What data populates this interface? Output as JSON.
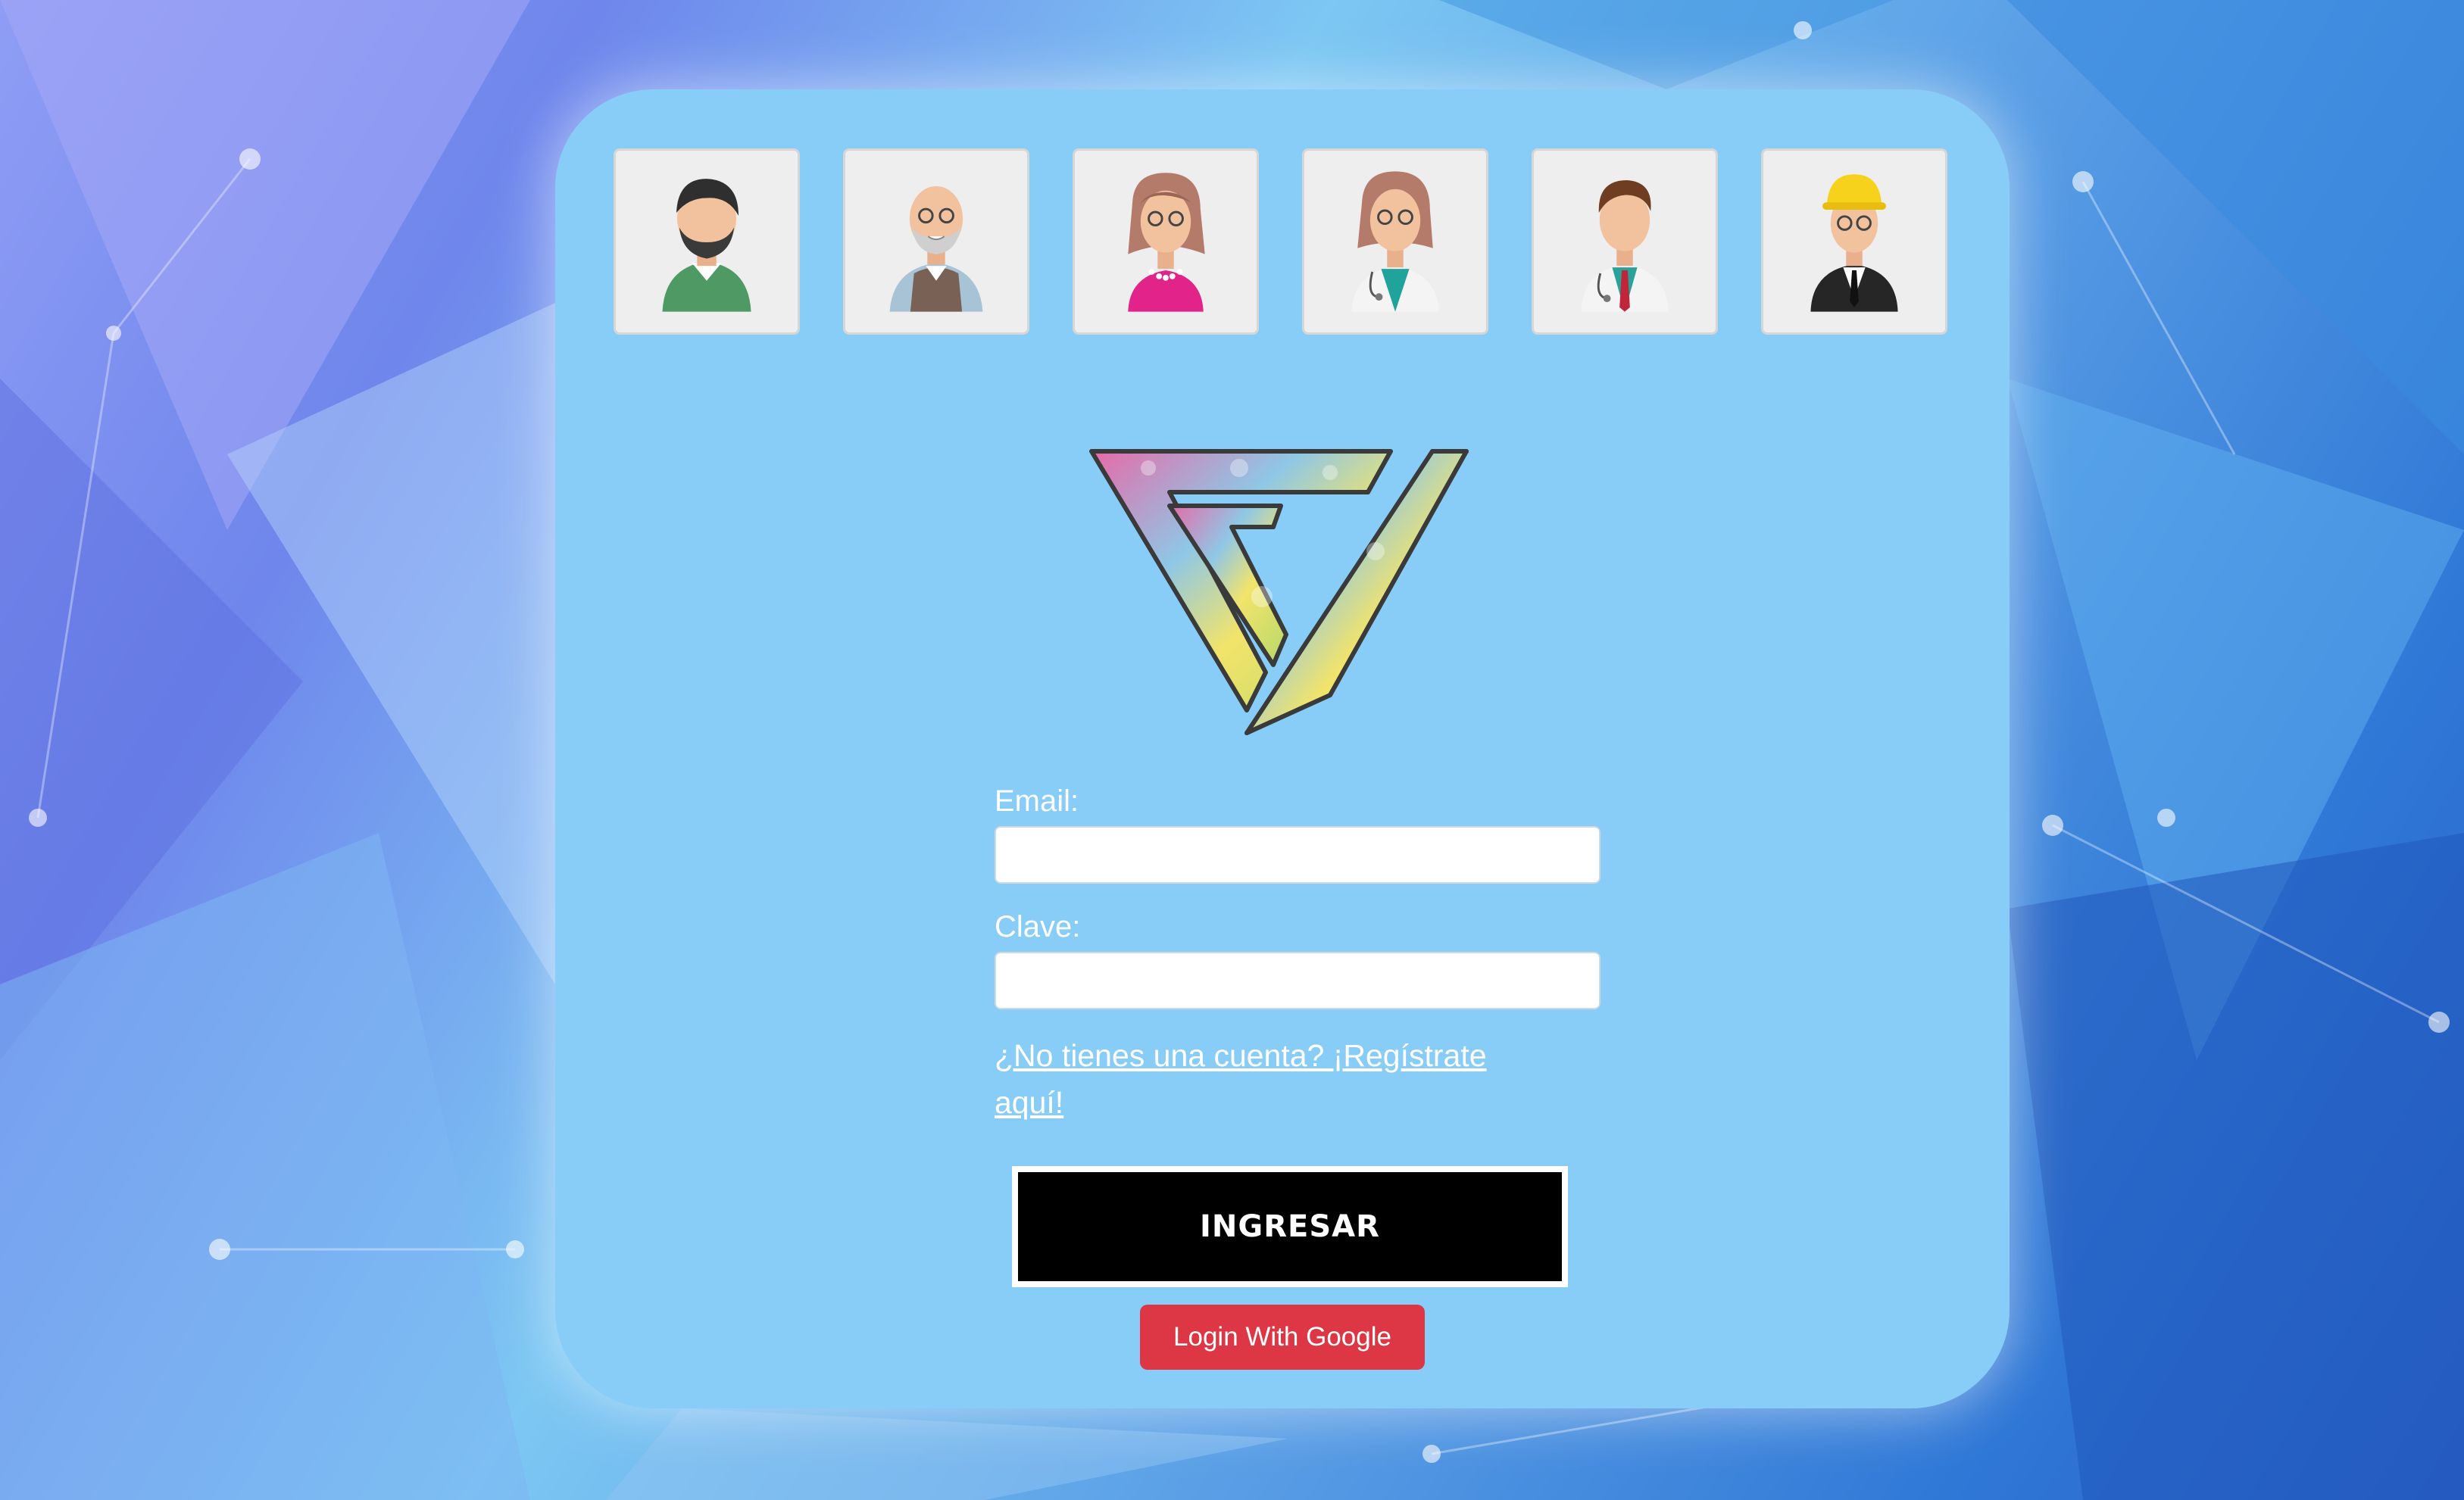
{
  "avatars": [
    {
      "name": "man-beard-green-sweater"
    },
    {
      "name": "elderly-man-vest"
    },
    {
      "name": "woman-pink-top"
    },
    {
      "name": "female-doctor"
    },
    {
      "name": "male-doctor"
    },
    {
      "name": "engineer-hardhat"
    }
  ],
  "form": {
    "email_label": "Email:",
    "email_value": "",
    "password_label": "Clave:",
    "password_value": "",
    "register_link": "¿No tienes una cuenta? ¡Regístrate aquí!",
    "submit_label": "INGRESAR",
    "google_label": "Login With Google"
  },
  "colors": {
    "card": "#88ccf8",
    "submit_bg": "#000000",
    "google_bg": "#dd3645",
    "text": "#ffffff"
  }
}
